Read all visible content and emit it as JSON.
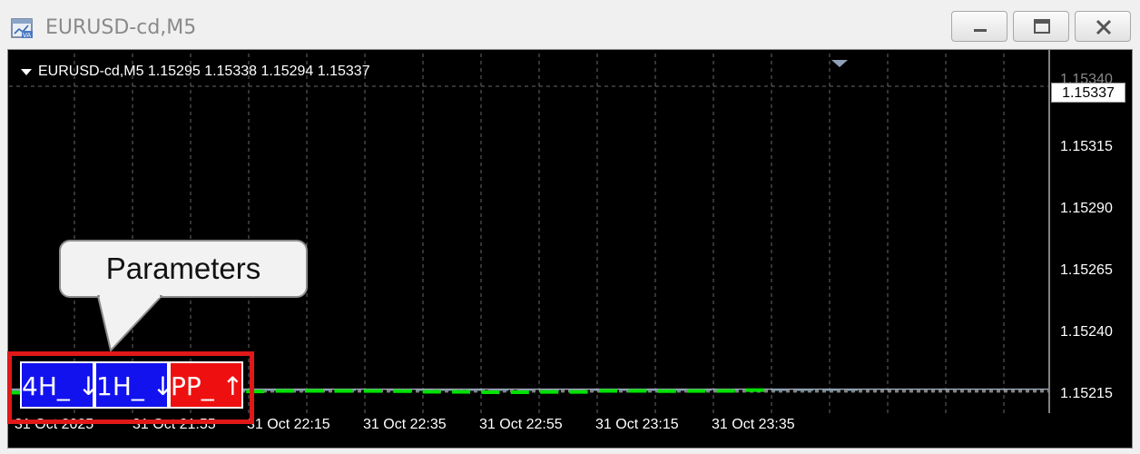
{
  "window": {
    "title": "EURUSD-cd,M5",
    "buttons": [
      "minimize",
      "maximize",
      "close"
    ]
  },
  "chart": {
    "symbol_line": "EURUSD-cd,M5  1.15295 1.15338 1.15294 1.15337",
    "current_price": "1.15337",
    "top_partial_label": "1.15340",
    "price_axis": [
      "1.15315",
      "1.15290",
      "1.15265",
      "1.15240",
      "1.15215"
    ],
    "time_axis": [
      "31 Oct 2025",
      "31 Oct 21:55",
      "31 Oct 22:15",
      "31 Oct 22:35",
      "31 Oct 22:55",
      "31 Oct 23:15",
      "31 Oct 23:35"
    ],
    "colors": {
      "background": "#000000",
      "bull_outline": "#00e000",
      "bear_fill": "#ffffff",
      "grid": "#c0c0c0",
      "dashed_level": "#6f97a8"
    }
  },
  "chart_data": {
    "type": "candlestick",
    "symbol": "EURUSD-cd",
    "timeframe": "M5",
    "ylim": [
      1.1521,
      1.15345
    ],
    "candles": [
      {
        "o": 1.15234,
        "h": 1.15237,
        "l": 1.15215,
        "c": 1.15237,
        "bull": true
      },
      {
        "o": 1.15232,
        "h": 1.15238,
        "l": 1.15221,
        "c": 1.15224,
        "bull": false
      },
      {
        "o": 1.15234,
        "h": 1.15256,
        "l": 1.15221,
        "c": 1.1525,
        "bull": true
      },
      {
        "o": 1.15245,
        "h": 1.15255,
        "l": 1.15237,
        "c": 1.15237,
        "bull": false
      },
      {
        "o": 1.1524,
        "h": 1.15251,
        "l": 1.15229,
        "c": 1.15237,
        "bull": false
      },
      {
        "o": 1.15232,
        "h": 1.15252,
        "l": 1.15221,
        "c": 1.15251,
        "bull": true
      },
      {
        "o": 1.1526,
        "h": 1.15275,
        "l": 1.15255,
        "c": 1.1527,
        "bull": true
      },
      {
        "o": 1.1527,
        "h": 1.1528,
        "l": 1.15265,
        "c": 1.15275,
        "bull": true
      },
      {
        "o": 1.15275,
        "h": 1.15288,
        "l": 1.1527,
        "c": 1.15285,
        "bull": true
      },
      {
        "o": 1.15285,
        "h": 1.15305,
        "l": 1.1528,
        "c": 1.15305,
        "bull": true
      },
      {
        "o": 1.15307,
        "h": 1.15312,
        "l": 1.15302,
        "c": 1.15308,
        "bull": true
      },
      {
        "o": 1.15305,
        "h": 1.15308,
        "l": 1.15292,
        "c": 1.15302,
        "bull": false
      },
      {
        "o": 1.15303,
        "h": 1.15314,
        "l": 1.15298,
        "c": 1.15301,
        "bull": false
      },
      {
        "o": 1.15297,
        "h": 1.15297,
        "l": 1.15267,
        "c": 1.15272,
        "bull": false
      },
      {
        "o": 1.15272,
        "h": 1.15272,
        "l": 1.15263,
        "c": 1.15265,
        "bull": false
      },
      {
        "o": 1.15268,
        "h": 1.15272,
        "l": 1.15245,
        "c": 1.15251,
        "bull": false
      },
      {
        "o": 1.15252,
        "h": 1.15254,
        "l": 1.15234,
        "c": 1.15249,
        "bull": false
      },
      {
        "o": 1.15252,
        "h": 1.15257,
        "l": 1.1524,
        "c": 1.15252,
        "bull": true
      },
      {
        "o": 1.15253,
        "h": 1.15271,
        "l": 1.15253,
        "c": 1.15264,
        "bull": true
      },
      {
        "o": 1.15264,
        "h": 1.15275,
        "l": 1.15245,
        "c": 1.15246,
        "bull": false
      },
      {
        "o": 1.15246,
        "h": 1.15309,
        "l": 1.15246,
        "c": 1.15307,
        "bull": true
      },
      {
        "o": 1.15307,
        "h": 1.15307,
        "l": 1.15288,
        "c": 1.153,
        "bull": false
      },
      {
        "o": 1.15298,
        "h": 1.1532,
        "l": 1.15283,
        "c": 1.15285,
        "bull": false
      },
      {
        "o": 1.15285,
        "h": 1.15309,
        "l": 1.15285,
        "c": 1.15304,
        "bull": true
      },
      {
        "o": 1.15306,
        "h": 1.15308,
        "l": 1.1529,
        "c": 1.15293,
        "bull": false
      },
      {
        "o": 1.15295,
        "h": 1.15338,
        "l": 1.15294,
        "c": 1.15337,
        "bull": true
      }
    ],
    "dashed_level": 1.15308,
    "last_price": 1.15337
  },
  "callout": {
    "text": "Parameters"
  },
  "param_buttons": [
    {
      "label": "4H_ ↓",
      "color": "#1212ee"
    },
    {
      "label": "1H_ ↓",
      "color": "#1212ee"
    },
    {
      "label": "PP_ ↑",
      "color": "#ee1010"
    }
  ]
}
